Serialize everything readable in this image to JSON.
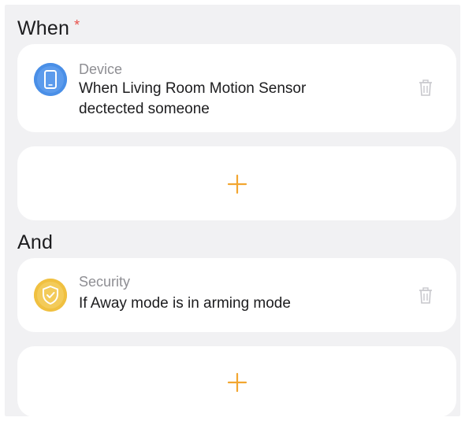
{
  "when_section": {
    "title": "When",
    "required_mark": "*",
    "conditions": [
      {
        "category": "Device",
        "description_lines": [
          "When Living Room Motion Sensor",
          "dectected someone"
        ],
        "icon": "phone-device-icon"
      }
    ],
    "add_icon": "plus-icon"
  },
  "and_section": {
    "title": "And",
    "conditions": [
      {
        "category": "Security",
        "description_lines": [
          "If Away mode is in arming mode"
        ],
        "icon": "shield-icon"
      }
    ],
    "add_icon": "plus-icon"
  },
  "colors": {
    "accent": "#f2a630",
    "device_blue": "#4a8fe7",
    "security_yellow": "#f0c040",
    "required_red": "#e8504a"
  }
}
